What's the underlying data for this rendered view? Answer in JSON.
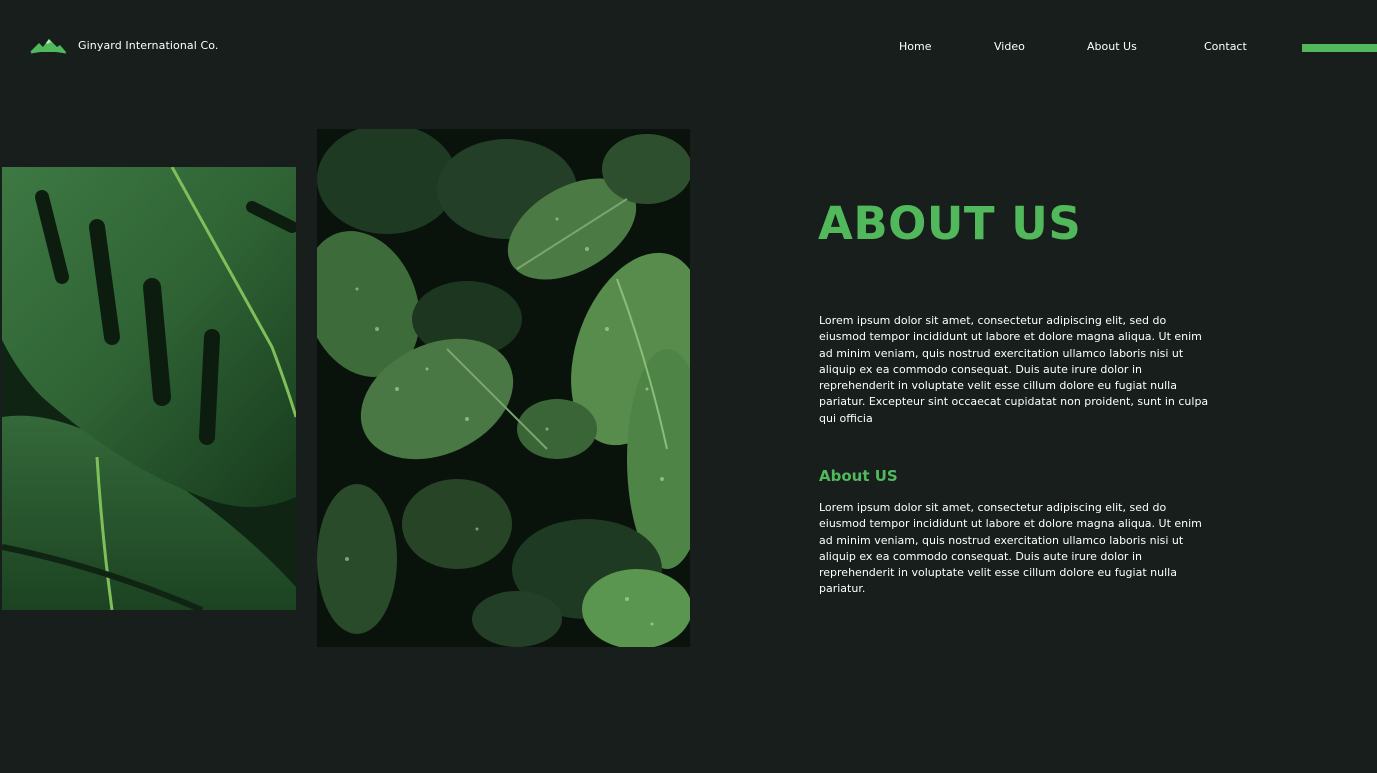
{
  "brand": {
    "name": "Ginyard International Co.",
    "logo_icon": "mountain-icon"
  },
  "nav": {
    "items": [
      {
        "label": "Home"
      },
      {
        "label": "Video"
      },
      {
        "label": "About Us"
      },
      {
        "label": "Contact"
      }
    ]
  },
  "colors": {
    "background": "#171e1b",
    "accent": "#52b85c",
    "text": "#ffffff"
  },
  "images": [
    {
      "subject": "monstera-leaves"
    },
    {
      "subject": "wet-green-leaves"
    }
  ],
  "about": {
    "heading": "ABOUT US",
    "paragraph_1": "Lorem ipsum dolor sit amet, consectetur adipiscing elit, sed do eiusmod tempor incididunt ut labore et dolore magna aliqua. Ut enim ad minim veniam, quis nostrud exercitation ullamco laboris nisi ut aliquip ex ea commodo consequat. Duis aute irure dolor in reprehenderit in voluptate velit esse cillum dolore eu fugiat nulla pariatur. Excepteur sint occaecat cupidatat non proident, sunt in culpa qui officia",
    "subheading": "About US",
    "paragraph_2": "Lorem ipsum dolor sit amet, consectetur adipiscing elit, sed do eiusmod tempor incididunt ut labore et dolore magna aliqua. Ut enim ad minim veniam, quis nostrud exercitation ullamco laboris nisi ut aliquip ex ea commodo consequat. Duis aute irure dolor in reprehenderit in voluptate velit esse cillum dolore eu fugiat nulla pariatur."
  }
}
